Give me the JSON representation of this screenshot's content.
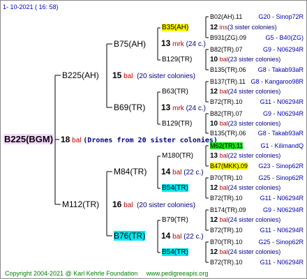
{
  "header": {
    "date": "1-  10-2021  ( 16:  58)"
  },
  "footer": {
    "copyright": "Copyright 2004-2021 @ Karl Kehrle Foundation",
    "site": "www.pedigreeapis.org"
  },
  "root": {
    "name": "B225(BGM)",
    "num": "18",
    "bal": "bal",
    "drones": "(Drones from 20 sister colonies)"
  },
  "gen2": [
    {
      "name": "B225(AH)",
      "num": "15",
      "bal": "bal",
      "sis": "(20 sister colonies)"
    },
    {
      "name": "M112(TR)",
      "num": "16",
      "bal": "bal",
      "sis": "(20 sister colonies)"
    }
  ],
  "gen3": [
    {
      "name": "B75(AH)",
      "num": "13",
      "mark": "mrk",
      "sis": "(24 c.)"
    },
    {
      "name": "B69(TR)",
      "num": "13",
      "mark": "mrk",
      "sis": "(24 c.)"
    },
    {
      "name": "M84(TR)",
      "num": "14",
      "mark": "bal",
      "sis": "(22 c.)"
    },
    {
      "name": "B76(TR)",
      "num": "14",
      "mark": "bal",
      "sis": "(22 c.)"
    }
  ],
  "gen4": [
    {
      "name": "B35(AH)",
      "num": "12",
      "mark": "ins",
      "sis": "(3 sister colonies)"
    },
    {
      "name": "B129(TR)",
      "num": "10",
      "mark": "bal",
      "sis": "(23 sister colonies)"
    },
    {
      "name": "B63(TR)",
      "num": "12",
      "mark": "bal",
      "sis": "(24 sister colonies)"
    },
    {
      "name": "B129(TR)",
      "num": "10",
      "mark": "bal",
      "sis": "(23 sister colonies)"
    },
    {
      "name": "M180(TR)",
      "num": "13",
      "mark": "bal",
      "sis": "(22 sister colonies)"
    },
    {
      "name": "B54(TR)",
      "num": "12",
      "mark": "bal",
      "sis": "(24 sister colonies)"
    },
    {
      "name": "B79(TR)",
      "num": "12",
      "mark": "bal",
      "sis": "(24 sister colonies)"
    },
    {
      "name": "B54(TR)",
      "num": "12",
      "mark": "bal",
      "sis": "(24 sister colonies)"
    }
  ],
  "gen5": [
    {
      "name": "B02(AH).11",
      "colony": "G20 - Sinop72R"
    },
    {
      "name": "B931(ZG).09",
      "colony": "G5 - B40(ZG)"
    },
    {
      "name": "B82(TR).07",
      "colony": "G9 - N06294R"
    },
    {
      "name": "B135(TR).06",
      "colony": "G8 - Takab93aR"
    },
    {
      "name": "B137(TR).11",
      "colony": "G8 - Kangaroo98R"
    },
    {
      "name": "B72(TR).10",
      "colony": "G11 - N06294R"
    },
    {
      "name": "B82(TR).07",
      "colony": "G9 - N06294R"
    },
    {
      "name": "B135(TR).06",
      "colony": "G8 - Takab93aR"
    },
    {
      "name": "M62(TR).11",
      "colony": "G1 - KilimandQ"
    },
    {
      "name": "B47(MKK).09",
      "colony": "G23 - Sinop62R"
    },
    {
      "name": "B70(TR).10",
      "colony": "G25 - Sinop62R"
    },
    {
      "name": "B72(TR).10",
      "colony": "G11 - N06294R"
    },
    {
      "name": "B174(TR).09",
      "colony": "G9 - N06294R"
    },
    {
      "name": "B72(TR).10",
      "colony": "G11 - N06294R"
    },
    {
      "name": "B70(TR).10",
      "colony": "G25 - Sinop62R"
    },
    {
      "name": "B72(TR).10",
      "colony": "G11 - N06294R"
    }
  ]
}
